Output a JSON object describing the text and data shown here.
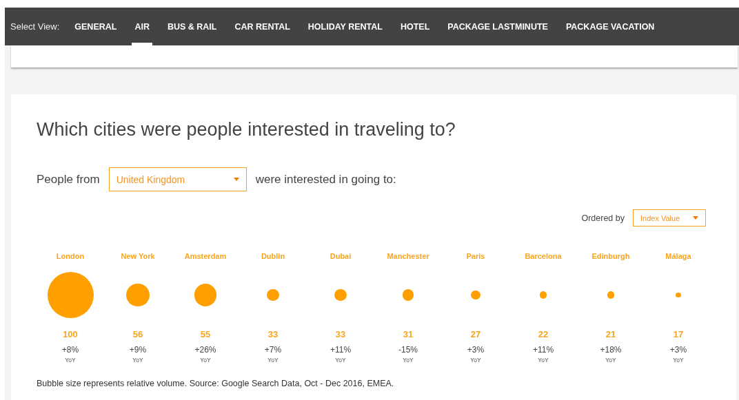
{
  "nav": {
    "label": "Select View:",
    "tabs": [
      {
        "label": "GENERAL",
        "selected": false
      },
      {
        "label": "AIR",
        "selected": true
      },
      {
        "label": "BUS & RAIL",
        "selected": false
      },
      {
        "label": "CAR RENTAL",
        "selected": false
      },
      {
        "label": "HOLIDAY RENTAL",
        "selected": false
      },
      {
        "label": "HOTEL",
        "selected": false
      },
      {
        "label": "PACKAGE LASTMINUTE",
        "selected": false
      },
      {
        "label": "PACKAGE VACATION",
        "selected": false
      }
    ]
  },
  "section": {
    "title": "Which cities were people interested in traveling to?",
    "origin_prefix": "People from",
    "origin_select": "United Kingdom",
    "origin_suffix": "were interested in going to:",
    "order_label": "Ordered by",
    "order_select": "Index Value",
    "cities": [
      {
        "name": "London",
        "value": "100",
        "change": "+8%",
        "change_label": "YoY"
      },
      {
        "name": "New York",
        "value": "56",
        "change": "+9%",
        "change_label": "YoY"
      },
      {
        "name": "Amsterdam",
        "value": "55",
        "change": "+26%",
        "change_label": "YoY"
      },
      {
        "name": "Dublin",
        "value": "33",
        "change": "+7%",
        "change_label": "YoY"
      },
      {
        "name": "Dubai",
        "value": "33",
        "change": "+11%",
        "change_label": "YoY"
      },
      {
        "name": "Manchester",
        "value": "31",
        "change": "-15%",
        "change_label": "YoY"
      },
      {
        "name": "Paris",
        "value": "27",
        "change": "+3%",
        "change_label": "YoY"
      },
      {
        "name": "Barcelona",
        "value": "22",
        "change": "+11%",
        "change_label": "YoY"
      },
      {
        "name": "Edinburgh",
        "value": "21",
        "change": "+18%",
        "change_label": "YoY"
      },
      {
        "name": "Málaga",
        "value": "17",
        "change": "+3%",
        "change_label": "YoY"
      }
    ],
    "footnote": "Bubble size represents relative volume. Source: Google Search Data, Oct - Dec 2016, EMEA."
  }
}
